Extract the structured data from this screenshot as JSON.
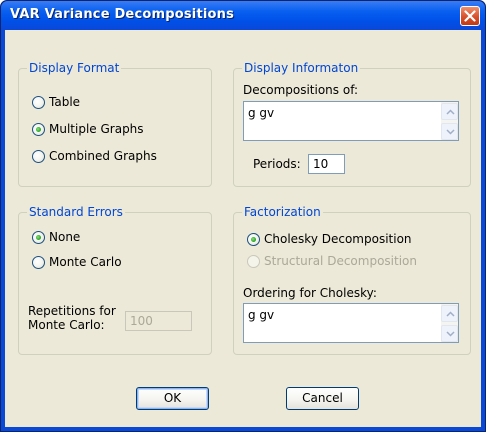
{
  "window": {
    "title": "VAR Variance Decompositions"
  },
  "display_format": {
    "legend": "Display Format",
    "options": [
      {
        "label": "Table",
        "selected": false
      },
      {
        "label": "Multiple Graphs",
        "selected": true
      },
      {
        "label": "Combined Graphs",
        "selected": false
      }
    ]
  },
  "display_information": {
    "legend": "Display Informaton",
    "decompositions_label": "Decompositions of:",
    "decompositions_value": "g gv",
    "periods_label": "Periods:",
    "periods_value": "10"
  },
  "standard_errors": {
    "legend": "Standard Errors",
    "options": [
      {
        "label": "None",
        "selected": true
      },
      {
        "label": "Monte Carlo",
        "selected": false
      }
    ],
    "repetitions_label_line1": "Repetitions for",
    "repetitions_label_line2": "Monte Carlo:",
    "repetitions_value": "100"
  },
  "factorization": {
    "legend": "Factorization",
    "options": [
      {
        "label": "Cholesky Decomposition",
        "selected": true,
        "enabled": true
      },
      {
        "label": "Structural Decomposition",
        "selected": false,
        "enabled": false
      }
    ],
    "ordering_label": "Ordering for Cholesky:",
    "ordering_value": "g gv"
  },
  "buttons": {
    "ok": "OK",
    "cancel": "Cancel"
  },
  "colors": {
    "titlebar": "#0A48D8",
    "dialog_bg": "#ECE9D8",
    "legend_text": "#0046D5",
    "radio_dot": "#21A121",
    "close_button": "#D8502C"
  }
}
